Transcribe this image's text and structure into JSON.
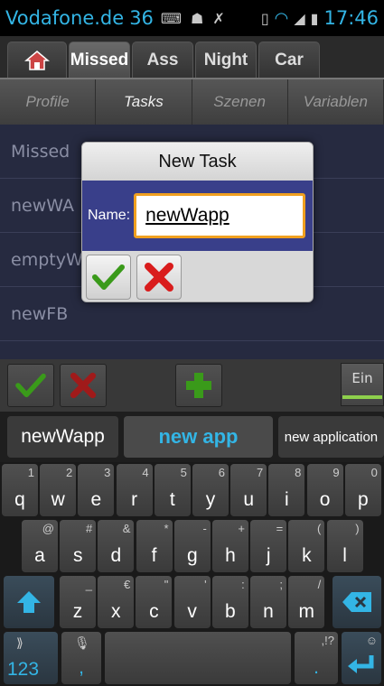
{
  "status_bar": {
    "carrier": "Vodafone.de",
    "network_count": "36",
    "time": "17:46"
  },
  "project_tabs": [
    {
      "label": "",
      "icon": "home-icon"
    },
    {
      "label": "Missed"
    },
    {
      "label": "Ass"
    },
    {
      "label": "Night"
    },
    {
      "label": "Car"
    }
  ],
  "section_tabs": [
    "Profile",
    "Tasks",
    "Szenen",
    "Variablen"
  ],
  "list_items": [
    "Missed",
    "newWA",
    "emptyW",
    "newFB"
  ],
  "dialog": {
    "title": "New Task",
    "name_label": "Name:",
    "name_value": "newWapp",
    "ok_icon": "checkmark-icon",
    "cancel_icon": "x-icon"
  },
  "action_bar": {
    "ein_label": "Ein"
  },
  "suggestions": [
    "newWapp",
    "new app",
    "new application"
  ],
  "keyboard": {
    "row1": [
      {
        "main": "q",
        "sub": "1"
      },
      {
        "main": "w",
        "sub": "2"
      },
      {
        "main": "e",
        "sub": "3"
      },
      {
        "main": "r",
        "sub": "4"
      },
      {
        "main": "t",
        "sub": "5"
      },
      {
        "main": "y",
        "sub": "6"
      },
      {
        "main": "u",
        "sub": "7"
      },
      {
        "main": "i",
        "sub": "8"
      },
      {
        "main": "o",
        "sub": "9"
      },
      {
        "main": "p",
        "sub": "0"
      }
    ],
    "row2": [
      {
        "main": "a",
        "sub": "@"
      },
      {
        "main": "s",
        "sub": "#"
      },
      {
        "main": "d",
        "sub": "&"
      },
      {
        "main": "f",
        "sub": "*"
      },
      {
        "main": "g",
        "sub": "-"
      },
      {
        "main": "h",
        "sub": "+"
      },
      {
        "main": "j",
        "sub": "="
      },
      {
        "main": "k",
        "sub": "("
      },
      {
        "main": "l",
        "sub": ")"
      }
    ],
    "row3": [
      {
        "main": "z",
        "sub": "_"
      },
      {
        "main": "x",
        "sub": "€"
      },
      {
        "main": "c",
        "sub": "\""
      },
      {
        "main": "v",
        "sub": "'"
      },
      {
        "main": "b",
        "sub": ":"
      },
      {
        "main": "n",
        "sub": ";"
      },
      {
        "main": "m",
        "sub": "/"
      }
    ],
    "numbers_label": "123",
    "comma_label": ",",
    "period_label": ".",
    "punct_label": ",!?"
  },
  "colors": {
    "accent": "#33b5e5",
    "dialog_body": "#393f8a",
    "field_border": "#f0a020",
    "list_bg": "#262a40"
  }
}
